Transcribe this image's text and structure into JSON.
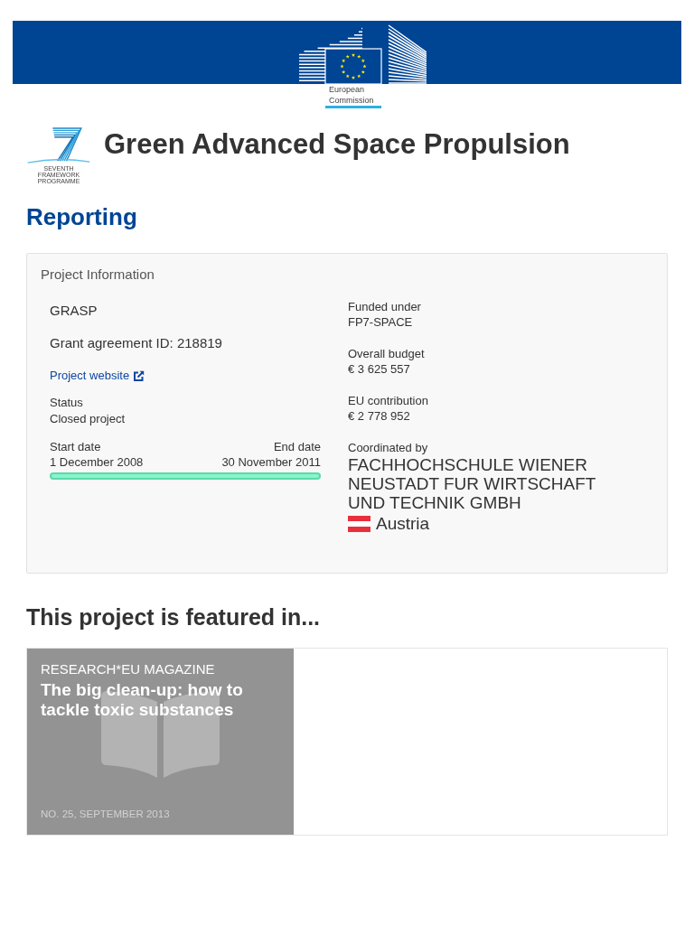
{
  "header": {
    "logo_text": "European Commission"
  },
  "project": {
    "logo_caption": "SEVENTH FRAMEWORK PROGRAMME",
    "title": "Green Advanced Space Propulsion"
  },
  "section_title": "Reporting",
  "info_card": {
    "title": "Project Information",
    "acronym": "GRASP",
    "grant": "Grant agreement ID: 218819",
    "website_link": "Project website",
    "status": {
      "label": "Status",
      "value": "Closed project"
    },
    "timeline": {
      "start_label": "Start date",
      "start_value": "1 December 2008",
      "end_label": "End date",
      "end_value": "30 November 2011",
      "level": 1
    },
    "details": [
      {
        "label": "Funded under",
        "value": "FP7-SPACE"
      },
      {
        "label": "Overall budget",
        "value": "€ 3 625 557"
      },
      {
        "label": "EU contribution",
        "value": "€ 2 778 952"
      }
    ],
    "coordinator": {
      "label": "Coordinated by",
      "name": "FACHHOCHSCHULE WIENER NEUSTADT FUR WIRTSCHAFT UND TECHNIK GMBH",
      "country": "Austria"
    }
  },
  "featured": {
    "title": "This project is featured in...",
    "items": [
      {
        "category": "RESEARCH*EU MAGAZINE",
        "headline": "The big clean-up: how to tackle toxic substances",
        "issue": "NO. 25, SEPTEMBER 2013"
      }
    ]
  }
}
